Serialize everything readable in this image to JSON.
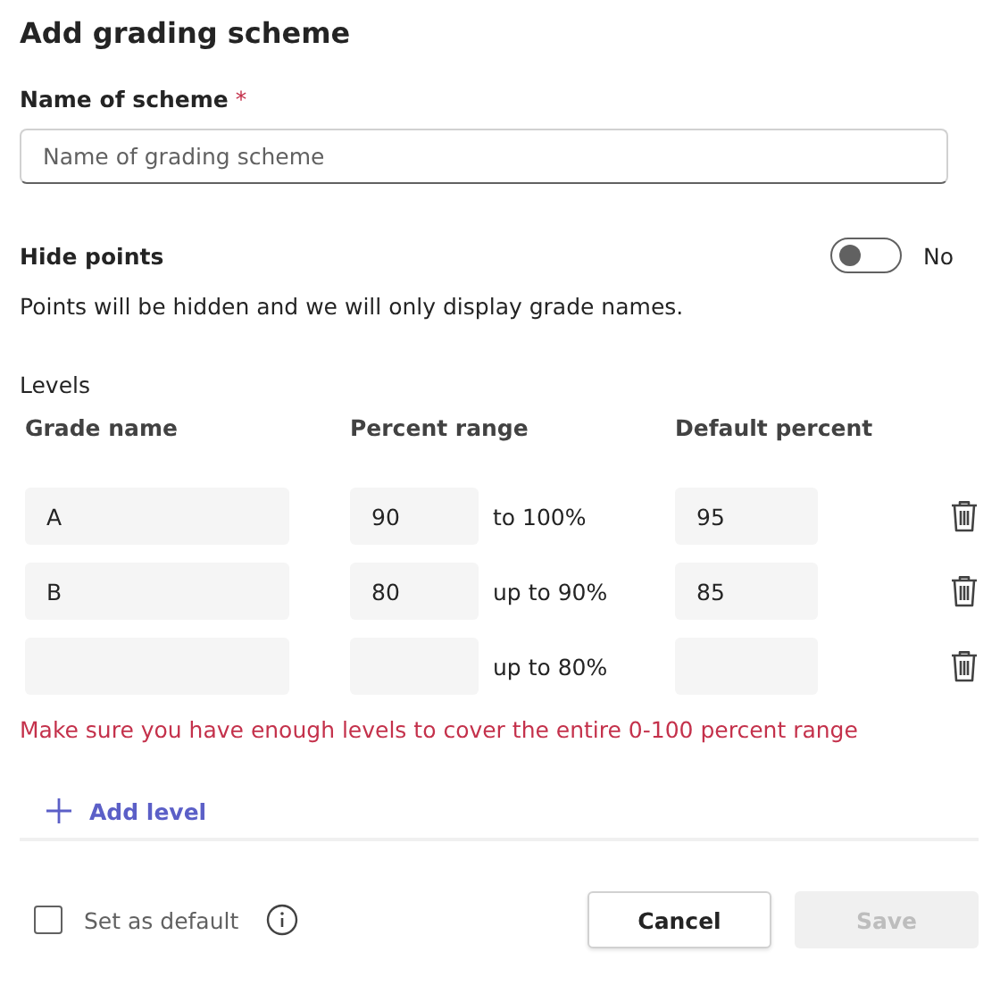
{
  "title": "Add grading scheme",
  "name_field": {
    "label": "Name of scheme",
    "required_mark": "*",
    "placeholder": "Name of grading scheme"
  },
  "hide_points": {
    "label": "Hide points",
    "on": false,
    "state_label": "No",
    "description": "Points will be hidden and we will only display grade names."
  },
  "levels": {
    "title": "Levels",
    "columns": [
      "Grade name",
      "Percent range",
      "Default percent"
    ],
    "rows": [
      {
        "grade": "A",
        "min": "90",
        "range_text": "to 100%",
        "default": "95"
      },
      {
        "grade": "B",
        "min": "80",
        "range_text": "up to 90%",
        "default": "85"
      },
      {
        "range_text": "up to 80%"
      }
    ],
    "error": "Make sure you have enough levels to cover the entire 0-100 percent range",
    "add_label": "Add level"
  },
  "footer": {
    "default_checkbox": {
      "label": "Set as default",
      "checked": false
    },
    "buttons": [
      {
        "label": "Cancel",
        "kind": "secondary",
        "disabled": false
      },
      {
        "label": "Save",
        "kind": "primary",
        "disabled": true
      }
    ]
  }
}
